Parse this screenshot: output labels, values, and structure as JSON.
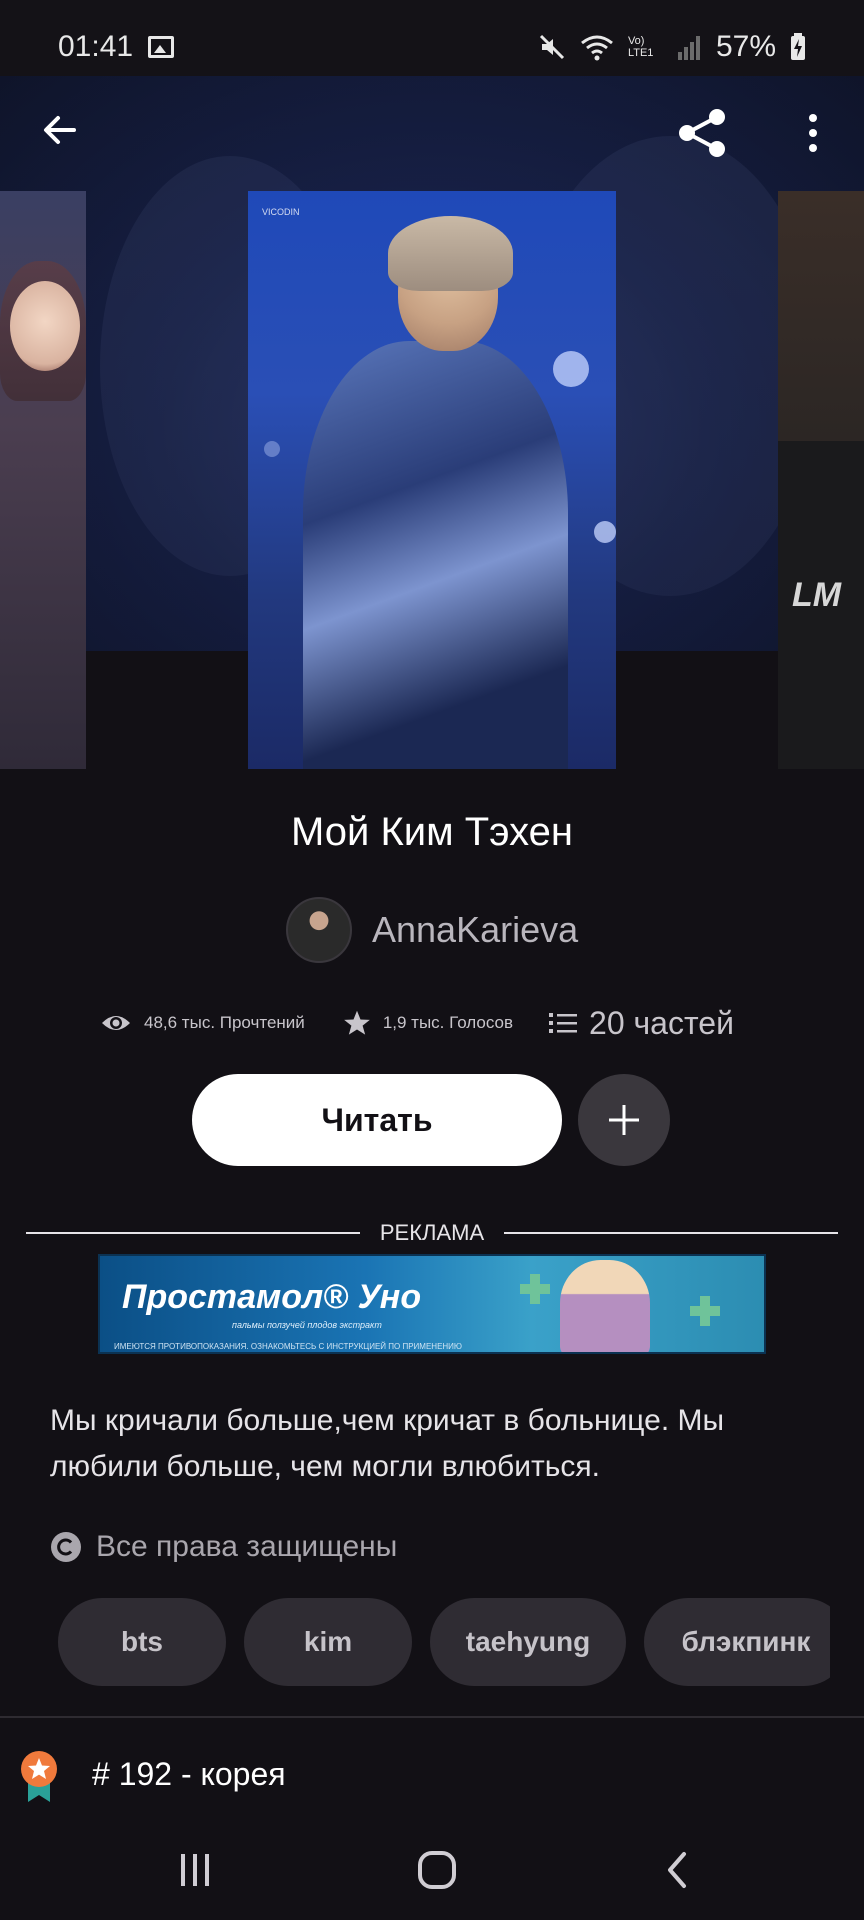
{
  "status_bar": {
    "time": "01:41",
    "network_label": "Vo) LTE1",
    "battery": "57%"
  },
  "toolbar": {
    "back_icon": "arrow-left-icon",
    "share_icon": "share-icon",
    "more_icon": "more-vertical-icon"
  },
  "covers": {
    "main_caption": "VICODIN"
  },
  "story": {
    "title": "Мой Ким Тэхен",
    "author": "AnnaKarieva",
    "stats": {
      "reads": "48,6 тыс. Прочтений",
      "votes": "1,9 тыс. Голосов",
      "parts": "20 частей"
    },
    "read_button": "Читать",
    "description": "Мы кричали больше,чем кричат в больнице. Мы любили больше, чем могли влюбиться.",
    "rights": "Все права защищены",
    "tags": [
      "bts",
      "kim",
      "taehyung",
      "блэкпинк"
    ],
    "ranking": "# 192 - корея"
  },
  "ad": {
    "label": "РЕКЛАМА",
    "banner_title": "Простамол® Уно",
    "banner_subtitle": "пальмы ползучей плодов экстракт",
    "banner_note": "ИМЕЮТСЯ ПРОТИВОПОКАЗАНИЯ. ОЗНАКОМЬТЕСЬ С ИНСТРУКЦИЕЙ ПО ПРИМЕНЕНИЮ"
  },
  "colors": {
    "background": "#121015",
    "button_primary": "#ffffff",
    "chip": "#2f2c33",
    "badge": "#f07a3c",
    "badge_ribbon": "#2aa198"
  }
}
